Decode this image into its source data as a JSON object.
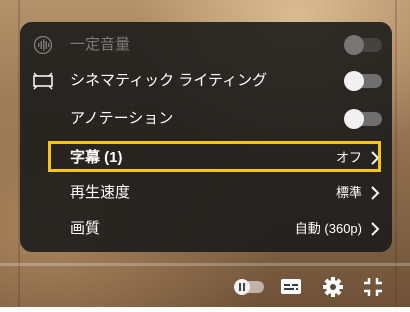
{
  "settings_menu": {
    "stable_volume": {
      "label": "一定音量",
      "enabled": false,
      "icon": "stable-volume-icon"
    },
    "ambient_mode": {
      "label": "シネマティック ライティング",
      "enabled": false,
      "icon": "ambient-mode-icon"
    },
    "annotations": {
      "label": "アノテーション",
      "enabled": false
    },
    "subtitles": {
      "label": "字幕 (1)",
      "value": "オフ"
    },
    "playback_speed": {
      "label": "再生速度",
      "value": "標準"
    },
    "quality": {
      "label": "画質",
      "value": "自動 (360p)"
    }
  },
  "controls": {
    "autoplay_icon": "autoplay-toggle-icon",
    "subtitles_icon": "subtitles-icon",
    "settings_icon": "gear-icon",
    "exit_fullscreen_icon": "exit-fullscreen-icon"
  },
  "colors": {
    "highlight": "#f5c518",
    "panel": "rgba(28,28,28,0.9)"
  }
}
